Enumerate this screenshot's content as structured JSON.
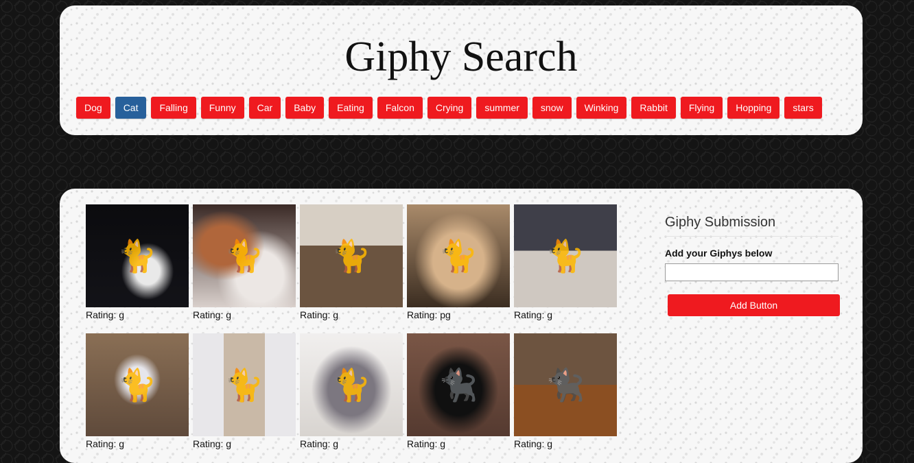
{
  "header": {
    "title": "Giphy Search",
    "topics": [
      {
        "label": "Dog",
        "active": false
      },
      {
        "label": "Cat",
        "active": true
      },
      {
        "label": "Falling",
        "active": false
      },
      {
        "label": "Funny",
        "active": false
      },
      {
        "label": "Car",
        "active": false
      },
      {
        "label": "Baby",
        "active": false
      },
      {
        "label": "Eating",
        "active": false
      },
      {
        "label": "Falcon",
        "active": false
      },
      {
        "label": "Crying",
        "active": false
      },
      {
        "label": "summer",
        "active": false
      },
      {
        "label": "snow",
        "active": false
      },
      {
        "label": "Winking",
        "active": false
      },
      {
        "label": "Rabbit",
        "active": false
      },
      {
        "label": "Flying",
        "active": false
      },
      {
        "label": "Hopping",
        "active": false
      },
      {
        "label": "stars",
        "active": false
      }
    ]
  },
  "gifs": [
    {
      "rating": "Rating: g",
      "icon": "cat-icon"
    },
    {
      "rating": "Rating: g",
      "icon": "cat-icon"
    },
    {
      "rating": "Rating: g",
      "icon": "cat-icon"
    },
    {
      "rating": "Rating: pg",
      "icon": "cat-icon"
    },
    {
      "rating": "Rating: g",
      "icon": "cat-icon"
    },
    {
      "rating": "Rating: g",
      "icon": "cat-icon"
    },
    {
      "rating": "Rating: g",
      "icon": "cat-icon"
    },
    {
      "rating": "Rating: g",
      "icon": "cat-icon"
    },
    {
      "rating": "Rating: g",
      "icon": "cat-icon"
    },
    {
      "rating": "Rating: g",
      "icon": "cat-icon"
    }
  ],
  "submission": {
    "title": "Giphy Submission",
    "label": "Add your Giphys below",
    "input_value": "",
    "button_label": "Add Button"
  },
  "colors": {
    "button_red": "#ef1a1f",
    "button_active_blue": "#27609b",
    "page_background": "#141414"
  }
}
